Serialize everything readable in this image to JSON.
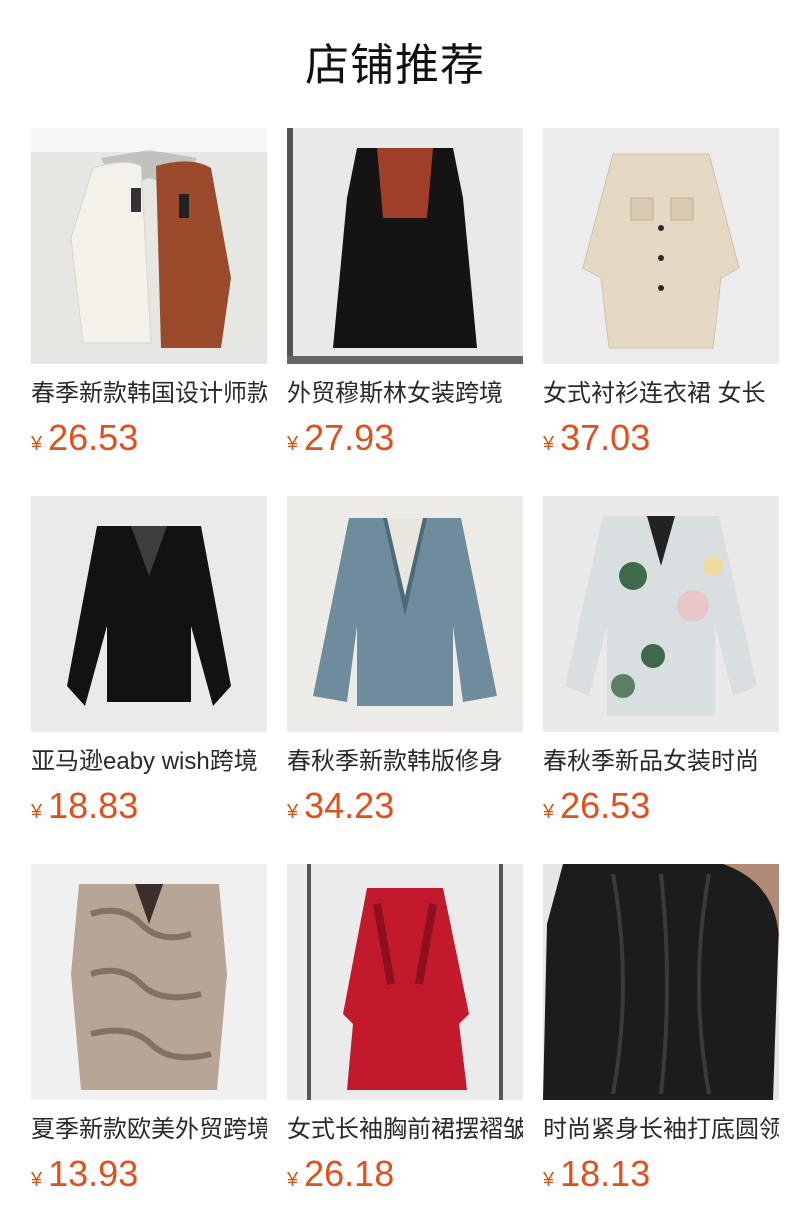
{
  "header": {
    "title": "店铺推荐"
  },
  "currency_symbol": "¥",
  "products": [
    {
      "name": "春季新款韩国设计师款",
      "price": "26.53",
      "colors": [
        "#f3f1ea",
        "#9a4a2a",
        "#e6e6e2"
      ]
    },
    {
      "name": "外贸穆斯林女装跨境",
      "price": "27.93",
      "colors": [
        "#141414",
        "#b8452e",
        "#e9e9e9"
      ]
    },
    {
      "name": "女式衬衫连衣裙 女长",
      "price": "37.03",
      "colors": [
        "#e5d9c3",
        "#2a2a2a",
        "#ececec"
      ]
    },
    {
      "name": "亚马逊eaby wish跨境",
      "price": "18.83",
      "colors": [
        "#121212",
        "#2a2a2a",
        "#eaeaea"
      ]
    },
    {
      "name": "春秋季新款韩版修身",
      "price": "34.23",
      "colors": [
        "#6e8c9c",
        "#4d6a79",
        "#ecebe8"
      ]
    },
    {
      "name": "春秋季新品女装时尚",
      "price": "26.53",
      "colors": [
        "#d9dee0",
        "#3f6a4a",
        "#e9e9e9"
      ]
    },
    {
      "name": "夏季新款欧美外贸跨境",
      "price": "13.93",
      "colors": [
        "#b8a596",
        "#6f5a4d",
        "#f0f0f0"
      ]
    },
    {
      "name": "女式长袖胸前裙摆褶皱",
      "price": "26.18",
      "colors": [
        "#c3192d",
        "#8e0f1e",
        "#ebebeb"
      ]
    },
    {
      "name": "时尚紧身长袖打底圆领",
      "price": "18.13",
      "colors": [
        "#1c1c1c",
        "#3a3a3a",
        "#e7e7e7"
      ]
    }
  ]
}
